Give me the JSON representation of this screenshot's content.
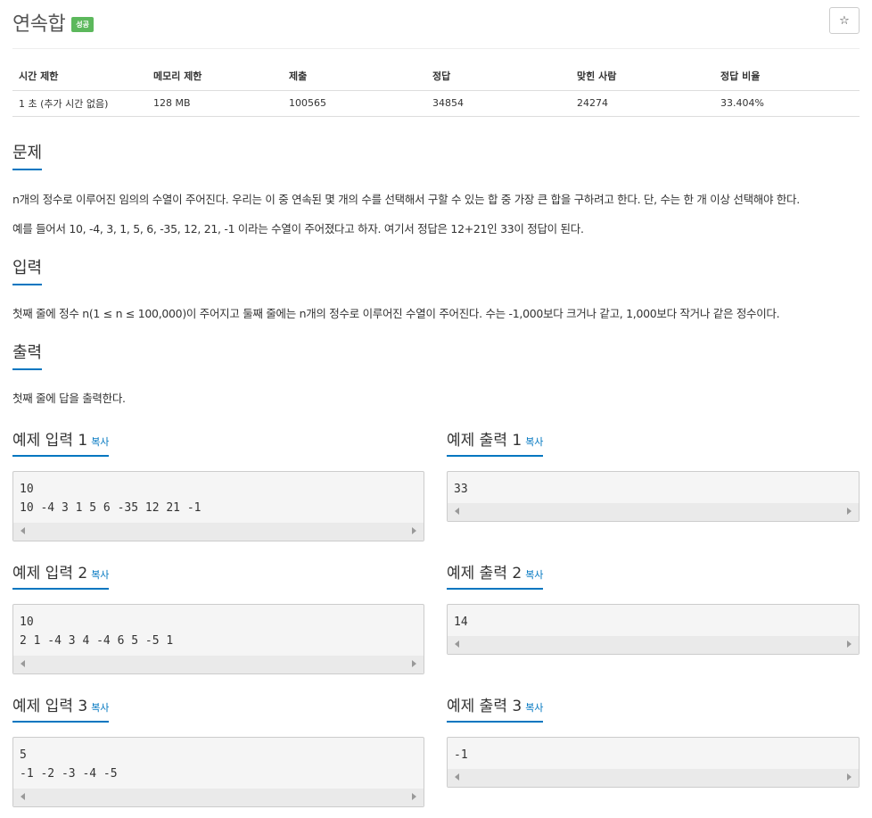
{
  "problem": {
    "title": "연속합",
    "badge": "성공",
    "star": "☆"
  },
  "info_table": {
    "headers": [
      "시간 제한",
      "메모리 제한",
      "제출",
      "정답",
      "맞힌 사람",
      "정답 비율"
    ],
    "values": [
      "1 초 (추가 시간 없음)",
      "128 MB",
      "100565",
      "34854",
      "24274",
      "33.404%"
    ]
  },
  "sections": {
    "problem": {
      "heading": "문제",
      "p1": "n개의 정수로 이루어진 임의의 수열이 주어진다. 우리는 이 중 연속된 몇 개의 수를 선택해서 구할 수 있는 합 중 가장 큰 합을 구하려고 한다. 단, 수는 한 개 이상 선택해야 한다.",
      "p2": "예를 들어서 10, -4, 3, 1, 5, 6, -35, 12, 21, -1 이라는 수열이 주어졌다고 하자. 여기서 정답은 12+21인 33이 정답이 된다."
    },
    "input": {
      "heading": "입력",
      "p1": "첫째 줄에 정수 n(1 ≤ n ≤ 100,000)이 주어지고 둘째 줄에는 n개의 정수로 이루어진 수열이 주어진다. 수는 -1,000보다 크거나 같고, 1,000보다 작거나 같은 정수이다."
    },
    "output": {
      "heading": "출력",
      "p1": "첫째 줄에 답을 출력한다."
    }
  },
  "copy_label": "복사",
  "examples": [
    {
      "in_title": "예제 입력 1",
      "in_lines": [
        "10",
        "10 -4 3 1 5 6 -35 12 21 -1"
      ],
      "out_title": "예제 출력 1",
      "out_lines": [
        "33"
      ]
    },
    {
      "in_title": "예제 입력 2",
      "in_lines": [
        "10",
        "2 1 -4 3 4 -4 6 5 -5 1"
      ],
      "out_title": "예제 출력 2",
      "out_lines": [
        "14"
      ]
    },
    {
      "in_title": "예제 입력 3",
      "in_lines": [
        "5",
        "-1 -2 -3 -4 -5"
      ],
      "out_title": "예제 출력 3",
      "out_lines": [
        "-1"
      ]
    }
  ]
}
